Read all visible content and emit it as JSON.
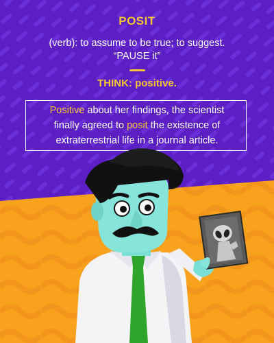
{
  "word": "POSIT",
  "definition": {
    "line1": "(verb): to assume to be true; to suggest.",
    "line2": "“PAUSE it”"
  },
  "think": "THINK: positive.",
  "example": {
    "line1_highlight": "Positive",
    "line1_rest": " about her findings, the scientist",
    "line2_pre": "finally agreed to ",
    "line2_highlight": "posit",
    "line2_post": " the existence of",
    "line3": "extraterrestrial life in a journal article."
  },
  "colors": {
    "background_purple": "#5b1fc4",
    "background_orange": "#f8a21e",
    "accent_yellow": "#f6c630",
    "text_white": "#ffffff"
  }
}
